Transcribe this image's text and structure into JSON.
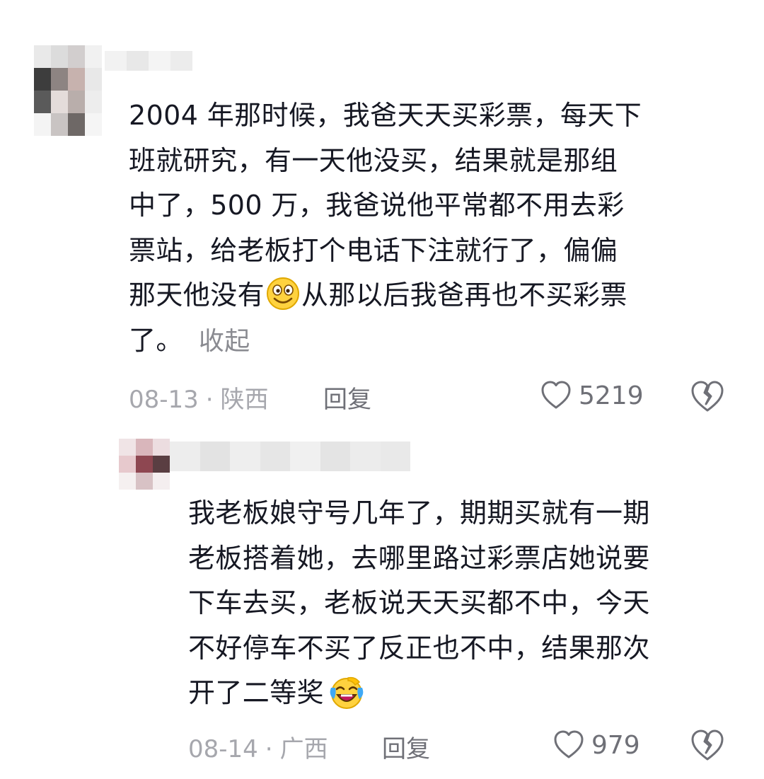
{
  "comments": [
    {
      "text_lines": [
        "2004 年那时候，我爸天天买彩票，每天下",
        "班就研究，有一天他没买，结果就是那组",
        "中了，500 万，我爸说他平常都不用去彩",
        "票站，给老板打个电话下注就行了，偏偏",
        "那天他没有",
        "从那以后我爸再也不买彩票",
        "了。"
      ],
      "emoji": "smiling-face-emoji",
      "collapse_label": "收起",
      "date": "08-13",
      "separator": "·",
      "location": "陕西",
      "reply_label": "回复",
      "like_count": "5219"
    },
    {
      "text_lines": [
        "我老板娘守号几年了，期期买就有一期",
        "老板搭着她，去哪里路过彩票店她说要",
        "下车去买，老板说天天买都不中，今天",
        "不好停车不买了反正也不中，结果那次",
        "开了二等奖"
      ],
      "emoji": "laughing-crying-emoji",
      "date": "08-14",
      "separator": "·",
      "location": "广西",
      "reply_label": "回复",
      "like_count": "979"
    }
  ],
  "colors": {
    "text": "#161823",
    "meta": "#a6a7ad",
    "action": "#6f7077"
  }
}
